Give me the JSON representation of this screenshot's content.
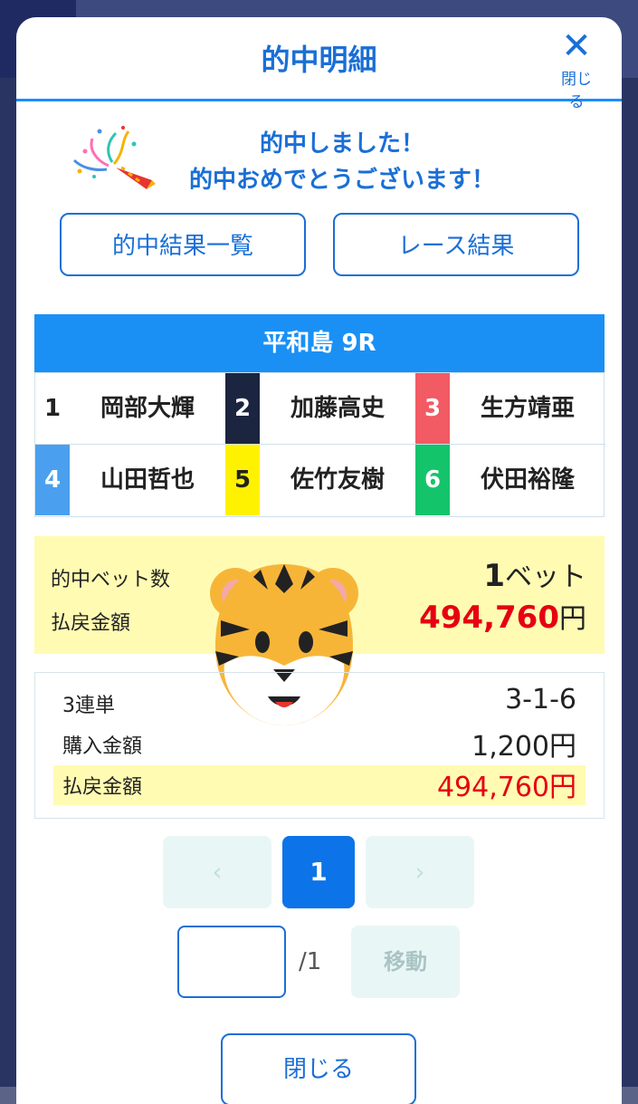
{
  "modal": {
    "title": "的中明細",
    "close_icon_label": "閉じる"
  },
  "congrats": {
    "line1": "的中しました！",
    "line2": "的中おめでとうございます！"
  },
  "buttons": {
    "hit_list": "的中結果一覧",
    "race_result": "レース結果"
  },
  "race": {
    "title": "平和島 9R",
    "riders": [
      {
        "num": "1",
        "name": "岡部大輝",
        "bg": "#ffffff",
        "fg": "#222222"
      },
      {
        "num": "2",
        "name": "加藤高史",
        "bg": "#1c2540",
        "fg": "#ffffff"
      },
      {
        "num": "3",
        "name": "生方靖亜",
        "bg": "#f25a64",
        "fg": "#ffffff"
      },
      {
        "num": "4",
        "name": "山田哲也",
        "bg": "#4aa0ef",
        "fg": "#ffffff"
      },
      {
        "num": "5",
        "name": "佐竹友樹",
        "bg": "#fff200",
        "fg": "#222222"
      },
      {
        "num": "6",
        "name": "伏田裕隆",
        "bg": "#14c46a",
        "fg": "#ffffff"
      }
    ]
  },
  "summary": {
    "bet_count_label": "的中ベット数",
    "bet_count_value": "1",
    "bet_count_unit": "ベット",
    "payout_label": "払戻金額",
    "payout_value": "494,760",
    "payout_unit": "円",
    "payout_color": "#e60012"
  },
  "detail": {
    "bet_type": "3連単",
    "combination": "3-1-6",
    "purchase_label": "購入金額",
    "purchase_value": "1,200円",
    "payout_label": "払戻金額",
    "payout_value": "494,760円"
  },
  "pagination": {
    "prev": "‹",
    "current": "1",
    "next": "›",
    "total": "/1",
    "move_label": "移動"
  },
  "footer": {
    "close_label": "閉じる"
  },
  "icons": {
    "close": "close-icon",
    "party_popper": "party-popper-icon",
    "tiger": "tiger-face-icon"
  }
}
